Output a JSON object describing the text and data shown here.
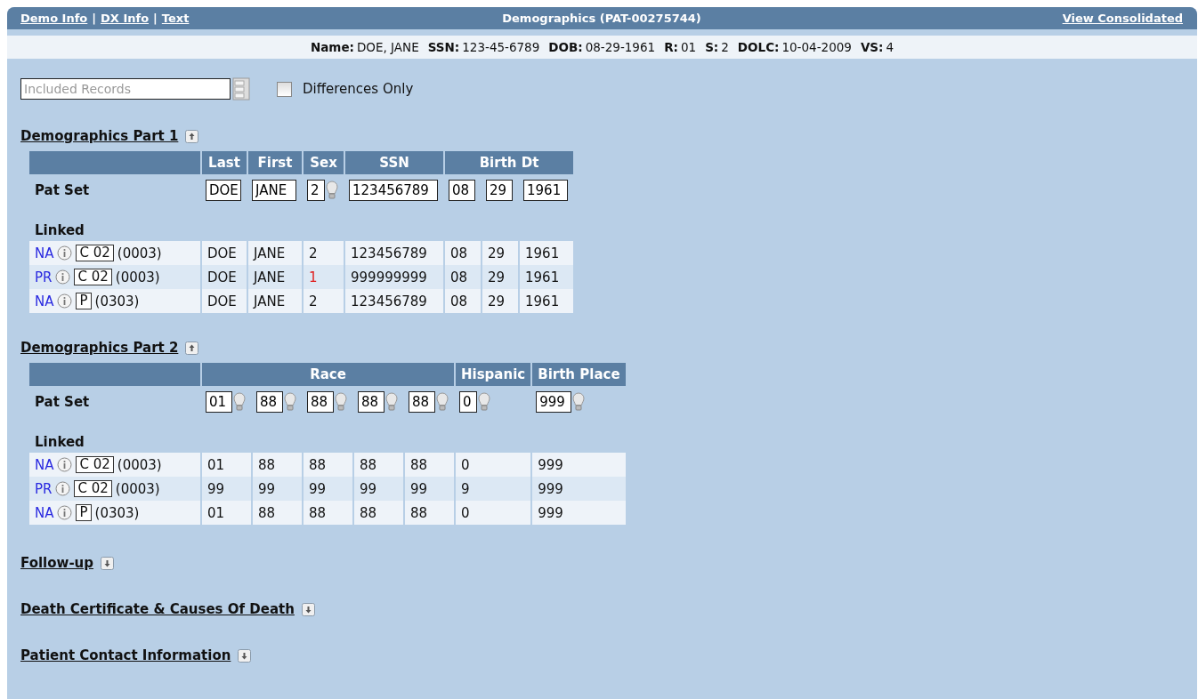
{
  "header": {
    "nav_links": [
      "Demo Info",
      "DX Info",
      "Text"
    ],
    "separator": "|",
    "title": "Demographics (PAT-00275744)",
    "right_link": "View Consolidated"
  },
  "patient_bar": [
    {
      "label": "Name:",
      "value": "DOE, JANE"
    },
    {
      "label": "SSN:",
      "value": "123-45-6789"
    },
    {
      "label": "DOB:",
      "value": "08-29-1961"
    },
    {
      "label": "R:",
      "value": "01"
    },
    {
      "label": "S:",
      "value": "2"
    },
    {
      "label": "DOLC:",
      "value": "10-04-2009"
    },
    {
      "label": "VS:",
      "value": "4"
    }
  ],
  "filter": {
    "placeholder": "Included Records",
    "checkbox_label": "Differences Only",
    "checked": false
  },
  "sections": [
    {
      "title": "Demographics Part 1",
      "expanded": true,
      "pat_set_label": "Pat Set",
      "groups": [
        {
          "label": "Last",
          "inputs": [
            {
              "value": "DOE",
              "hint": false
            }
          ]
        },
        {
          "label": "First",
          "inputs": [
            {
              "value": "JANE",
              "hint": false
            }
          ]
        },
        {
          "label": "Sex",
          "inputs": [
            {
              "value": "2",
              "hint": true
            }
          ]
        },
        {
          "label": "SSN",
          "inputs": [
            {
              "value": "123456789",
              "hint": false
            }
          ]
        },
        {
          "label": "Birth Dt",
          "inputs": [
            {
              "value": "08",
              "hint": false
            },
            {
              "value": "29",
              "hint": false
            },
            {
              "value": "1961",
              "hint": false
            }
          ]
        }
      ],
      "linked_label": "Linked",
      "rows": [
        {
          "source": "NA",
          "code": "C 02",
          "number": "(0003)",
          "cells": [
            {
              "text": "DOE",
              "differs": false
            },
            {
              "text": "JANE",
              "differs": false
            },
            {
              "text": "2",
              "differs": false
            },
            {
              "text": "123456789",
              "differs": false
            },
            {
              "text": "08",
              "differs": false
            },
            {
              "text": "29",
              "differs": false
            },
            {
              "text": "1961",
              "differs": false
            }
          ]
        },
        {
          "source": "PR",
          "code": "C 02",
          "number": "(0003)",
          "cells": [
            {
              "text": "DOE",
              "differs": false
            },
            {
              "text": "JANE",
              "differs": false
            },
            {
              "text": "1",
              "differs": true
            },
            {
              "text": "999999999",
              "differs": false
            },
            {
              "text": "08",
              "differs": false
            },
            {
              "text": "29",
              "differs": false
            },
            {
              "text": "1961",
              "differs": false
            }
          ]
        },
        {
          "source": "NA",
          "code": "P",
          "number": "(0303)",
          "cells": [
            {
              "text": "DOE",
              "differs": false
            },
            {
              "text": "JANE",
              "differs": false
            },
            {
              "text": "2",
              "differs": false
            },
            {
              "text": "123456789",
              "differs": false
            },
            {
              "text": "08",
              "differs": false
            },
            {
              "text": "29",
              "differs": false
            },
            {
              "text": "1961",
              "differs": false
            }
          ]
        }
      ]
    },
    {
      "title": "Demographics Part 2",
      "expanded": true,
      "pat_set_label": "Pat Set",
      "groups": [
        {
          "label": "Race",
          "inputs": [
            {
              "value": "01",
              "hint": true
            },
            {
              "value": "88",
              "hint": true
            },
            {
              "value": "88",
              "hint": true
            },
            {
              "value": "88",
              "hint": true
            },
            {
              "value": "88",
              "hint": true
            }
          ]
        },
        {
          "label": "Hispanic",
          "inputs": [
            {
              "value": "0",
              "hint": true
            }
          ]
        },
        {
          "label": "Birth Place",
          "inputs": [
            {
              "value": "999",
              "hint": true
            }
          ]
        }
      ],
      "linked_label": "Linked",
      "rows": [
        {
          "source": "NA",
          "code": "C 02",
          "number": "(0003)",
          "cells": [
            {
              "text": "01",
              "differs": false
            },
            {
              "text": "88",
              "differs": false
            },
            {
              "text": "88",
              "differs": false
            },
            {
              "text": "88",
              "differs": false
            },
            {
              "text": "88",
              "differs": false
            },
            {
              "text": "0",
              "differs": false
            },
            {
              "text": "999",
              "differs": false
            }
          ]
        },
        {
          "source": "PR",
          "code": "C 02",
          "number": "(0003)",
          "cells": [
            {
              "text": "99",
              "differs": false
            },
            {
              "text": "99",
              "differs": false
            },
            {
              "text": "99",
              "differs": false
            },
            {
              "text": "99",
              "differs": false
            },
            {
              "text": "99",
              "differs": false
            },
            {
              "text": "9",
              "differs": false
            },
            {
              "text": "999",
              "differs": false
            }
          ]
        },
        {
          "source": "NA",
          "code": "P",
          "number": "(0303)",
          "cells": [
            {
              "text": "01",
              "differs": false
            },
            {
              "text": "88",
              "differs": false
            },
            {
              "text": "88",
              "differs": false
            },
            {
              "text": "88",
              "differs": false
            },
            {
              "text": "88",
              "differs": false
            },
            {
              "text": "0",
              "differs": false
            },
            {
              "text": "999",
              "differs": false
            }
          ]
        }
      ]
    },
    {
      "title": "Follow-up",
      "expanded": false
    },
    {
      "title": "Death Certificate & Causes Of Death",
      "expanded": false
    },
    {
      "title": "Patient Contact Information",
      "expanded": false
    }
  ]
}
